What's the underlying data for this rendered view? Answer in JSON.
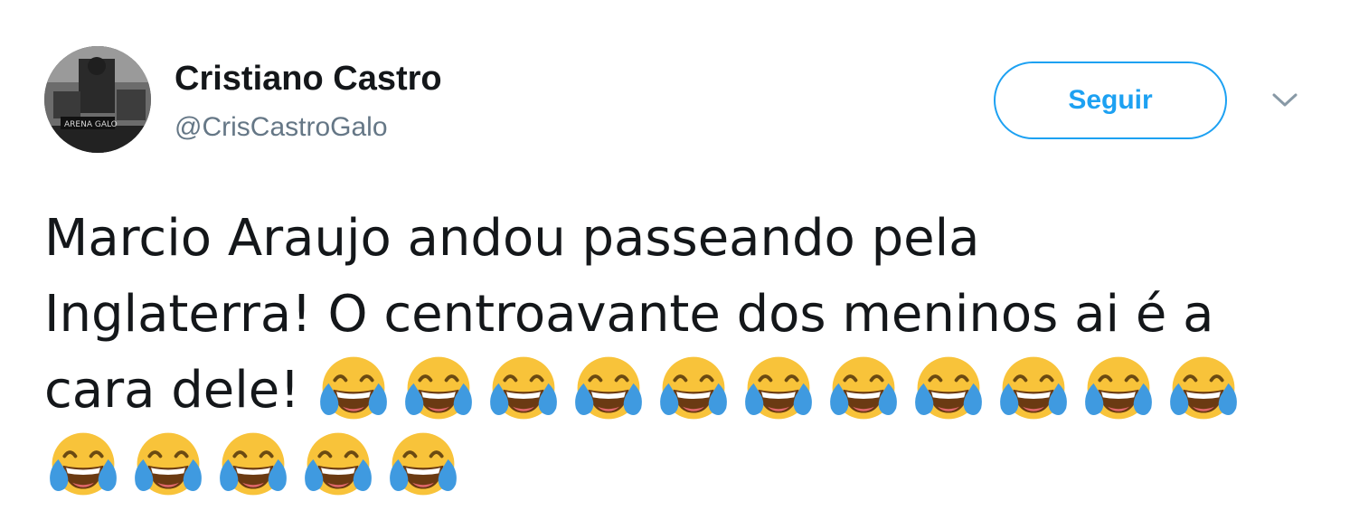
{
  "author": {
    "display_name": "Cristiano Castro",
    "handle": "@CrisCastroGalo",
    "avatar_text": "ARENA GALO"
  },
  "actions": {
    "follow_label": "Seguir",
    "menu_icon": "chevron-down-icon"
  },
  "tweet": {
    "line1": "Marcio Araujo andou passeando pela",
    "line2": "Inglaterra! O centroavante dos meninos ai é a",
    "line3_text": "cara dele!",
    "emoji_name": "face-with-tears-of-joy-icon",
    "emoji_count_line3": 11,
    "emoji_count_line4": 5
  },
  "colors": {
    "accent": "#1da1f2",
    "text": "#14171a",
    "secondary_text": "#657786",
    "emoji_face": "#f8c33a",
    "emoji_tear": "#3f9ae0"
  }
}
